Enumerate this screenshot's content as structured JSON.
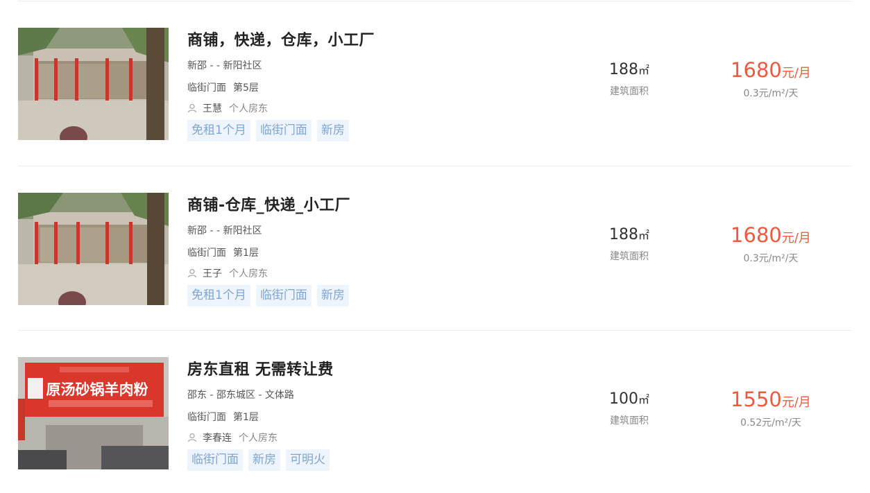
{
  "listings": [
    {
      "title": "商铺，快递，仓库，小工厂",
      "location": "新邵 - - 新阳社区",
      "shop_type": "临街门面",
      "floor": "第5层",
      "landlord_name": "王慧",
      "landlord_type": "个人房东",
      "tags": [
        "免租1个月",
        "临街门面",
        "新房"
      ],
      "area_value": "188",
      "area_unit": "㎡",
      "area_label": "建筑面积",
      "price_value": "1680",
      "price_unit": "元/月",
      "price_per_unit": "0.3元/m²/天",
      "photo_icon": "storefront-photo"
    },
    {
      "title": "商铺-仓库_快递_小工厂",
      "location": "新邵 - - 新阳社区",
      "shop_type": "临街门面",
      "floor": "第1层",
      "landlord_name": "王子",
      "landlord_type": "个人房东",
      "tags": [
        "免租1个月",
        "临街门面",
        "新房"
      ],
      "area_value": "188",
      "area_unit": "㎡",
      "area_label": "建筑面积",
      "price_value": "1680",
      "price_unit": "元/月",
      "price_per_unit": "0.3元/m²/天",
      "photo_icon": "storefront-photo"
    },
    {
      "title": "房东直租 无需转让费",
      "location": "邵东 - 邵东城区 - 文体路",
      "shop_type": "临街门面",
      "floor": "第1层",
      "landlord_name": "李春连",
      "landlord_type": "个人房东",
      "tags": [
        "临街门面",
        "新房",
        "可明火"
      ],
      "area_value": "100",
      "area_unit": "㎡",
      "area_label": "建筑面积",
      "price_value": "1550",
      "price_unit": "元/月",
      "price_per_unit": "0.52元/m²/天",
      "photo_icon": "noodle-shop-photo",
      "photo_sign_text": "原汤砂锅羊肉粉"
    }
  ],
  "colors": {
    "price": "#ec5b3f",
    "tag_bg": "#eef4fb",
    "tag_text": "#7ea6d4",
    "title": "#222222"
  }
}
